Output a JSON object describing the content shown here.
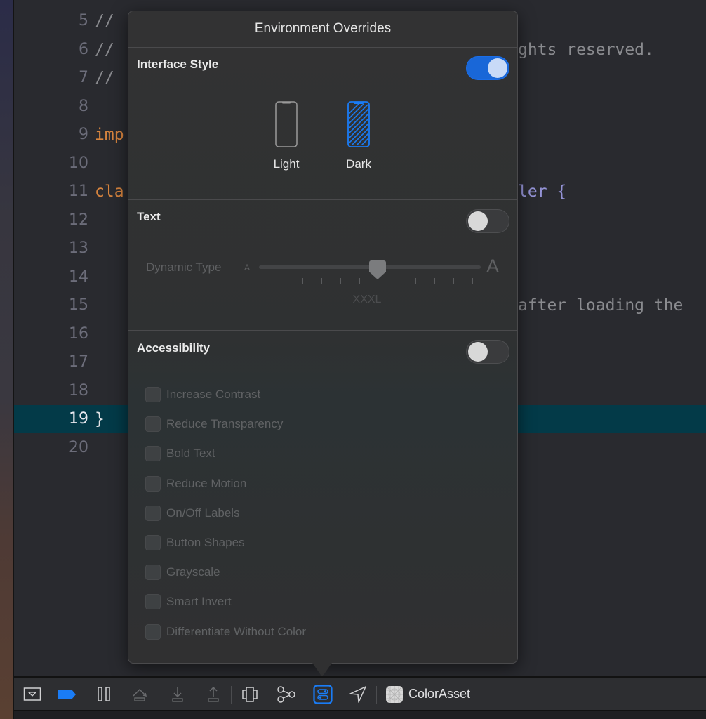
{
  "editor": {
    "current_line": 19,
    "lines": [
      {
        "num": "5",
        "segments": [
          {
            "cls": "tok-comment",
            "text": "//"
          }
        ]
      },
      {
        "num": "6",
        "segments": [
          {
            "cls": "tok-comment",
            "text": "//"
          }
        ],
        "tail": "ghts reserved."
      },
      {
        "num": "7",
        "segments": [
          {
            "cls": "tok-comment",
            "text": "//"
          }
        ]
      },
      {
        "num": "8",
        "segments": []
      },
      {
        "num": "9",
        "segments": [
          {
            "cls": "tok-kw",
            "text": "imp"
          }
        ]
      },
      {
        "num": "10",
        "segments": []
      },
      {
        "num": "11",
        "segments": [
          {
            "cls": "tok-kw",
            "text": "cla"
          }
        ],
        "tail": "ler {"
      },
      {
        "num": "12",
        "segments": []
      },
      {
        "num": "13",
        "segments": []
      },
      {
        "num": "14",
        "segments": []
      },
      {
        "num": "15",
        "segments": [],
        "tail": "after loading the"
      },
      {
        "num": "16",
        "segments": []
      },
      {
        "num": "17",
        "segments": []
      },
      {
        "num": "18",
        "segments": []
      },
      {
        "num": "19",
        "segments": [
          {
            "cls": "tok-plain",
            "text": "}"
          }
        ]
      },
      {
        "num": "20",
        "segments": []
      }
    ]
  },
  "popover": {
    "title": "Environment Overrides",
    "interface_style": {
      "title": "Interface Style",
      "enabled": true,
      "options": [
        {
          "label": "Light",
          "selected": false,
          "icon": "iphone-outline-icon"
        },
        {
          "label": "Dark",
          "selected": true,
          "icon": "iphone-hatched-icon"
        }
      ]
    },
    "text": {
      "title": "Text",
      "enabled": false,
      "dynamic_type": {
        "label": "Dynamic Type",
        "small_glyph": "A",
        "large_glyph": "A",
        "tick_count": 12,
        "selected_index": 6,
        "value_label": "XXXL"
      }
    },
    "accessibility": {
      "title": "Accessibility",
      "enabled": false,
      "options": [
        {
          "label": "Increase Contrast",
          "checked": false
        },
        {
          "label": "Reduce Transparency",
          "checked": false
        },
        {
          "label": "Bold Text",
          "checked": false
        },
        {
          "label": "Reduce Motion",
          "checked": false
        },
        {
          "label": "On/Off Labels",
          "checked": false
        },
        {
          "label": "Button Shapes",
          "checked": false
        },
        {
          "label": "Grayscale",
          "checked": false
        },
        {
          "label": "Smart Invert",
          "checked": false
        },
        {
          "label": "Differentiate Without Color",
          "checked": false
        }
      ]
    }
  },
  "debug_bar": {
    "buttons": [
      {
        "name": "hide-debug-area-button",
        "icon": "debug-area-toggle-icon"
      },
      {
        "name": "breakpoints-toggle-button",
        "icon": "breakpoint-icon",
        "active": true
      },
      {
        "name": "pause-button",
        "icon": "pause-icon"
      },
      {
        "name": "step-over-button",
        "icon": "step-over-icon",
        "disabled": true
      },
      {
        "name": "step-into-button",
        "icon": "step-into-icon",
        "disabled": true
      },
      {
        "name": "step-out-button",
        "icon": "step-out-icon",
        "disabled": true
      },
      {
        "name": "debug-view-hierarchy-button",
        "icon": "view-hierarchy-icon"
      },
      {
        "name": "memory-graph-button",
        "icon": "memory-graph-icon"
      },
      {
        "name": "environment-overrides-button",
        "icon": "environment-overrides-icon",
        "active": true
      },
      {
        "name": "simulate-location-button",
        "icon": "location-arrow-icon"
      }
    ],
    "scheme_label": "ColorAsset"
  },
  "colors": {
    "accent": "#1a7cf5",
    "toggle_on": "#1967d8",
    "current_line_bg": "#033a48",
    "keyword": "#d7843e",
    "type": "#9493d6"
  }
}
